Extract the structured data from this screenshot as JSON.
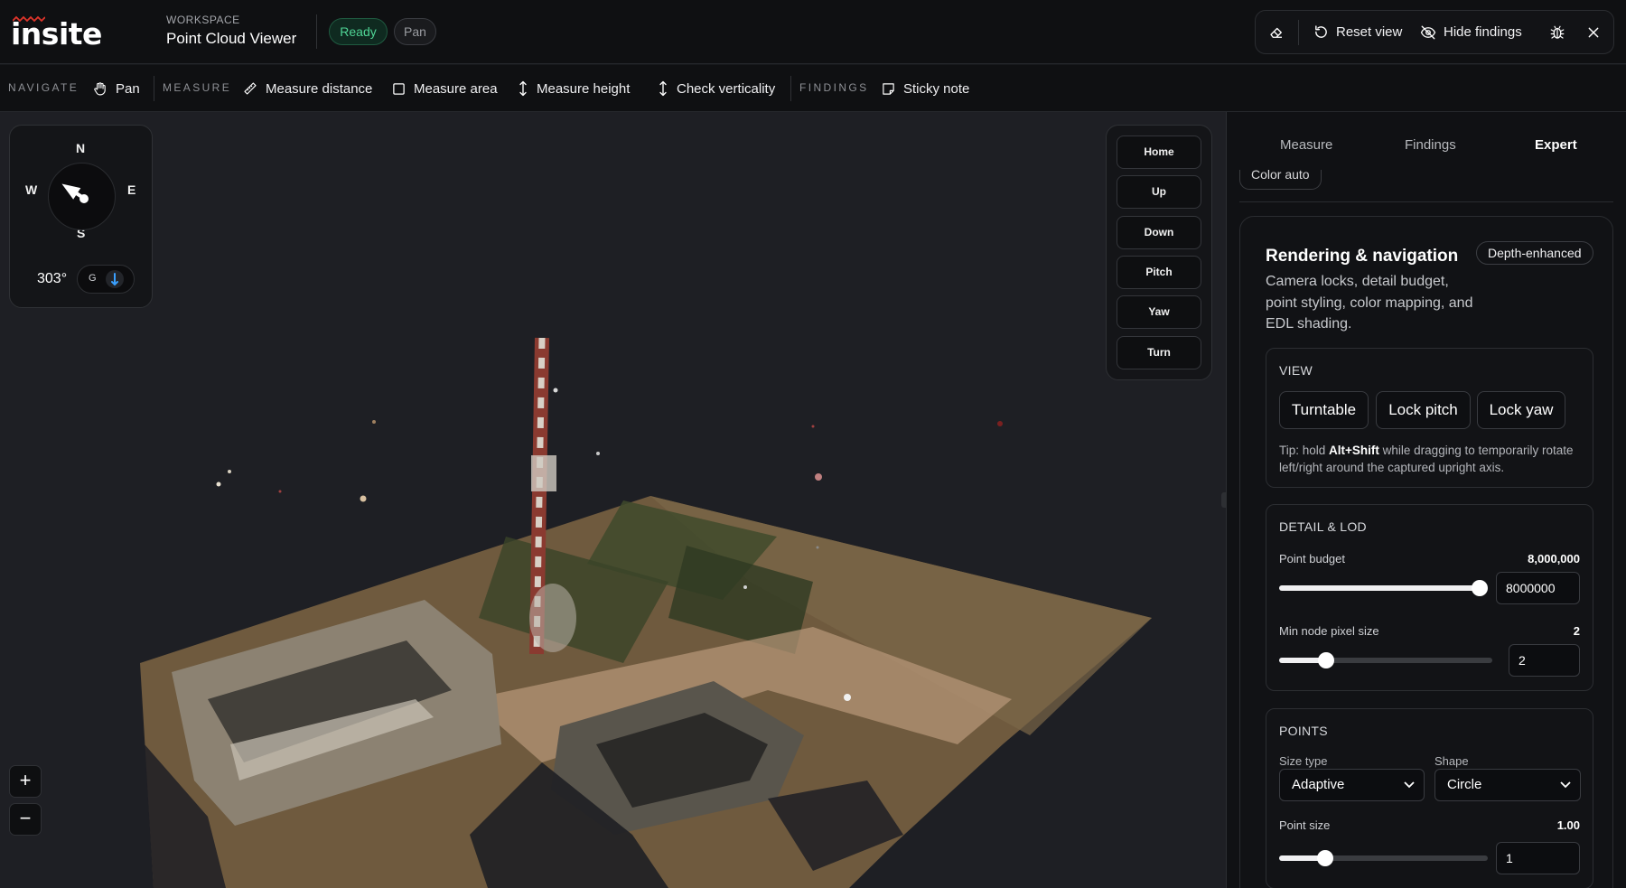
{
  "header": {
    "logo_text": "insite",
    "workspace_label": "WORKSPACE",
    "workspace_name": "Point Cloud Viewer",
    "status": "Ready",
    "mode": "Pan",
    "actions": {
      "reset_view": "Reset view",
      "hide_findings": "Hide findings"
    }
  },
  "toolbar": {
    "navigate_label": "NAVIGATE",
    "pan": "Pan",
    "measure_label": "MEASURE",
    "measure_distance": "Measure distance",
    "measure_area": "Measure area",
    "measure_height": "Measure height",
    "check_verticality": "Check verticality",
    "findings_label": "FINDINGS",
    "sticky_note": "Sticky note"
  },
  "compass": {
    "n": "N",
    "s": "S",
    "e": "E",
    "w": "W",
    "heading": "303°",
    "global_toggle": "G",
    "arrow_heading_deg": 303
  },
  "camera_controls": [
    "Home",
    "Up",
    "Down",
    "Pitch",
    "Yaw",
    "Turn"
  ],
  "zoom": {
    "in": "+",
    "out": "−"
  },
  "panel": {
    "tabs": [
      {
        "label": "Measure",
        "active": false
      },
      {
        "label": "Findings",
        "active": false
      },
      {
        "label": "Expert",
        "active": true
      }
    ],
    "clipped_chip": "Color auto",
    "card": {
      "title": "Rendering & navigation",
      "badge": "Depth-enhanced",
      "description": "Camera locks, detail budget, point styling, color mapping, and EDL shading.",
      "view": {
        "heading": "VIEW",
        "buttons": [
          "Turntable",
          "Lock pitch",
          "Lock yaw"
        ],
        "tip_prefix": "Tip: hold ",
        "tip_keys": "Alt+Shift",
        "tip_suffix": " while dragging to temporarily rotate left/right around the captured upright axis."
      },
      "detail": {
        "heading": "DETAIL & LOD",
        "point_budget_label": "Point budget",
        "point_budget_display": "8,000,000",
        "point_budget_input": "8000000",
        "point_budget_fraction": 1.0,
        "min_node_label": "Min node pixel size",
        "min_node_display": "2",
        "min_node_input": "2",
        "min_node_fraction": 0.22
      },
      "points": {
        "heading": "POINTS",
        "size_type_label": "Size type",
        "size_type_value": "Adaptive",
        "shape_label": "Shape",
        "shape_value": "Circle",
        "point_size_label": "Point size",
        "point_size_display": "1.00",
        "point_size_input": "1",
        "point_size_fraction": 0.22
      }
    }
  },
  "colors": {
    "accent_ready": "#4fd495",
    "brand_red": "#e0352b",
    "background": "#1e1f24"
  }
}
